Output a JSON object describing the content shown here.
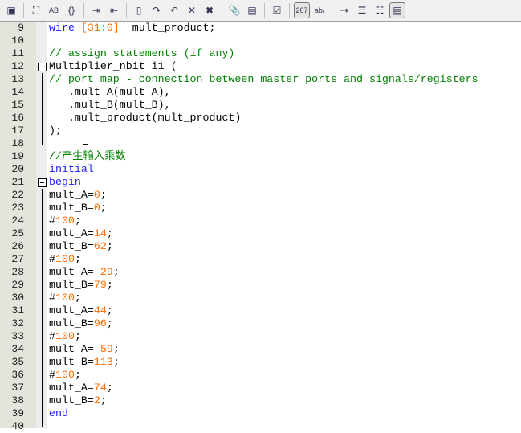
{
  "toolbar": {
    "buttons": [
      {
        "name": "window-icon",
        "g": "▣"
      },
      {
        "sep": true
      },
      {
        "name": "find-icon",
        "g": "⛶"
      },
      {
        "name": "replace-icon",
        "g": "A̲B"
      },
      {
        "name": "goto-brace-icon",
        "g": "{}"
      },
      {
        "sep": true
      },
      {
        "name": "indent-icon",
        "g": "⇥"
      },
      {
        "name": "outdent-icon",
        "g": "⇤"
      },
      {
        "sep": true
      },
      {
        "name": "bookmark-icon",
        "g": "▯"
      },
      {
        "name": "next-bookmark-icon",
        "g": "↷"
      },
      {
        "name": "prev-bookmark-icon",
        "g": "↶"
      },
      {
        "name": "clear-bookmark-icon",
        "g": "✕"
      },
      {
        "name": "clear-all-bookmarks-icon",
        "g": "✖"
      },
      {
        "sep": true
      },
      {
        "name": "attach-icon",
        "g": "📎"
      },
      {
        "name": "scroll-icon",
        "g": "▤"
      },
      {
        "sep": true
      },
      {
        "name": "check-icon",
        "g": "☑"
      },
      {
        "sep": true
      },
      {
        "name": "line-numbers-icon",
        "g": "267",
        "on": true
      },
      {
        "name": "word-wrap-icon",
        "g": "ab/"
      },
      {
        "sep": true
      },
      {
        "name": "show-tabs-icon",
        "g": "⇢"
      },
      {
        "name": "show-indent-icon",
        "g": "☰"
      },
      {
        "name": "fold-icon",
        "g": "☷"
      },
      {
        "name": "code-view-icon",
        "g": "▤",
        "on": true
      }
    ]
  },
  "editor": {
    "lines": [
      {
        "num": "9",
        "t": [
          [
            "k",
            "wire "
          ],
          [
            "n",
            "[31:0]"
          ],
          [
            "p",
            "  mult_product;"
          ]
        ]
      },
      {
        "num": "10",
        "t": []
      },
      {
        "num": "11",
        "t": [
          [
            "c",
            "// assign statements (if any)"
          ]
        ]
      },
      {
        "num": "12",
        "t": [
          [
            "p",
            "Multiplier_nbit i1 ("
          ]
        ],
        "fold": "open"
      },
      {
        "num": "13",
        "t": [
          [
            "c",
            "// port map - connection between master ports and signals/registers"
          ]
        ],
        "fold": "line"
      },
      {
        "num": "14",
        "t": [
          [
            "p",
            "   .mult_A(mult_A),"
          ]
        ],
        "fold": "line"
      },
      {
        "num": "15",
        "t": [
          [
            "p",
            "   .mult_B(mult_B),"
          ]
        ],
        "fold": "line"
      },
      {
        "num": "16",
        "t": [
          [
            "p",
            "   .mult_product(mult_product)"
          ]
        ],
        "fold": "line"
      },
      {
        "num": "17",
        "t": [
          [
            "p",
            ");"
          ]
        ],
        "fold": "line"
      },
      {
        "num": "18",
        "t": [],
        "fold": "end"
      },
      {
        "num": "19",
        "t": [
          [
            "c",
            "//产生输入乘数"
          ]
        ]
      },
      {
        "num": "20",
        "t": [
          [
            "k",
            "initial"
          ]
        ]
      },
      {
        "num": "21",
        "t": [
          [
            "k",
            "begin"
          ]
        ],
        "fold": "open"
      },
      {
        "num": "22",
        "t": [
          [
            "p",
            "mult_A="
          ],
          [
            "n",
            "0"
          ],
          [
            "p",
            ";"
          ]
        ],
        "fold": "line"
      },
      {
        "num": "23",
        "t": [
          [
            "p",
            "mult_B="
          ],
          [
            "n",
            "0"
          ],
          [
            "p",
            ";"
          ]
        ],
        "fold": "line"
      },
      {
        "num": "24",
        "t": [
          [
            "p",
            "#"
          ],
          [
            "n",
            "100"
          ],
          [
            "p",
            ";"
          ]
        ],
        "fold": "line"
      },
      {
        "num": "25",
        "t": [
          [
            "p",
            "mult_A="
          ],
          [
            "n",
            "14"
          ],
          [
            "p",
            ";"
          ]
        ],
        "fold": "line"
      },
      {
        "num": "26",
        "t": [
          [
            "p",
            "mult_B="
          ],
          [
            "n",
            "62"
          ],
          [
            "p",
            ";"
          ]
        ],
        "fold": "line"
      },
      {
        "num": "27",
        "t": [
          [
            "p",
            "#"
          ],
          [
            "n",
            "100"
          ],
          [
            "p",
            ";"
          ]
        ],
        "fold": "line"
      },
      {
        "num": "28",
        "t": [
          [
            "p",
            "mult_A=-"
          ],
          [
            "n",
            "29"
          ],
          [
            "p",
            ";"
          ]
        ],
        "fold": "line"
      },
      {
        "num": "29",
        "t": [
          [
            "p",
            "mult_B="
          ],
          [
            "n",
            "79"
          ],
          [
            "p",
            ";"
          ]
        ],
        "fold": "line"
      },
      {
        "num": "30",
        "t": [
          [
            "p",
            "#"
          ],
          [
            "n",
            "100"
          ],
          [
            "p",
            ";"
          ]
        ],
        "fold": "line"
      },
      {
        "num": "31",
        "t": [
          [
            "p",
            "mult_A="
          ],
          [
            "n",
            "44"
          ],
          [
            "p",
            ";"
          ]
        ],
        "fold": "line"
      },
      {
        "num": "32",
        "t": [
          [
            "p",
            "mult_B="
          ],
          [
            "n",
            "96"
          ],
          [
            "p",
            ";"
          ]
        ],
        "fold": "line"
      },
      {
        "num": "33",
        "t": [
          [
            "p",
            "#"
          ],
          [
            "n",
            "100"
          ],
          [
            "p",
            ";"
          ]
        ],
        "fold": "line"
      },
      {
        "num": "34",
        "t": [
          [
            "p",
            "mult_A=-"
          ],
          [
            "n",
            "59"
          ],
          [
            "p",
            ";"
          ]
        ],
        "fold": "line"
      },
      {
        "num": "35",
        "t": [
          [
            "p",
            "mult_B="
          ],
          [
            "n",
            "113"
          ],
          [
            "p",
            ";"
          ]
        ],
        "fold": "line"
      },
      {
        "num": "36",
        "t": [
          [
            "p",
            "#"
          ],
          [
            "n",
            "100"
          ],
          [
            "p",
            ";"
          ]
        ],
        "fold": "line"
      },
      {
        "num": "37",
        "t": [
          [
            "p",
            "mult_A="
          ],
          [
            "n",
            "74"
          ],
          [
            "p",
            ";"
          ]
        ],
        "fold": "line"
      },
      {
        "num": "38",
        "t": [
          [
            "p",
            "mult_B="
          ],
          [
            "n",
            "2"
          ],
          [
            "p",
            ";"
          ]
        ],
        "fold": "line"
      },
      {
        "num": "39",
        "t": [
          [
            "k",
            "end"
          ]
        ],
        "fold": "line"
      },
      {
        "num": "40",
        "t": [],
        "fold": "end"
      }
    ]
  }
}
